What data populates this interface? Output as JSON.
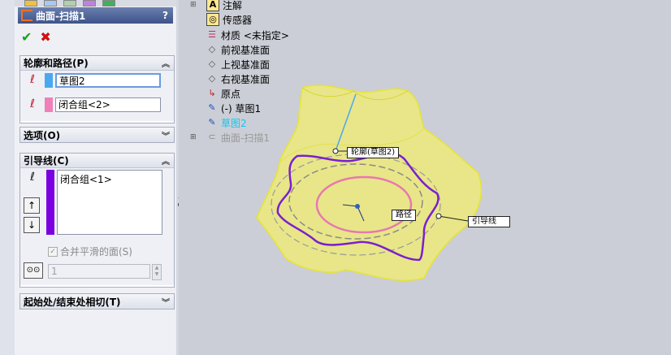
{
  "property_manager": {
    "title": "曲面-扫描1",
    "help": "?",
    "ok_symbol": "✔",
    "cancel_symbol": "✖",
    "profile_path": {
      "header": "轮廓和路径(P)",
      "profile_value": "草图2",
      "path_value": "闭合组<2>",
      "profile_color": "#4aa8f0",
      "path_color": "#f080b8"
    },
    "options": {
      "header": "选项(O)"
    },
    "guide_curves": {
      "header": "引导线(C)",
      "list_item": "闭合组<1>",
      "list_color": "#7a00e0",
      "up_arrow": "↑",
      "down_arrow": "↓",
      "merge_label": "合并平滑的面(S)",
      "merge_checked": true,
      "sections_value": "1"
    },
    "start_end_tangency": {
      "header": "起始处/结束处相切(T)"
    }
  },
  "feature_tree": {
    "items": [
      {
        "label": "注解",
        "icon": "annotations-icon",
        "expandable": true
      },
      {
        "label": "传感器",
        "icon": "sensor-icon",
        "expandable": false
      },
      {
        "label": "材质 <未指定>",
        "icon": "material-icon",
        "expandable": false
      },
      {
        "label": "前视基准面",
        "icon": "plane-icon",
        "expandable": false
      },
      {
        "label": "上视基准面",
        "icon": "plane-icon",
        "expandable": false
      },
      {
        "label": "右视基准面",
        "icon": "plane-icon",
        "expandable": false
      },
      {
        "label": "原点",
        "icon": "origin-icon",
        "expandable": false
      },
      {
        "label": "(-) 草图1",
        "icon": "sketch-icon",
        "expandable": false
      },
      {
        "label": "草图2",
        "icon": "sketch-icon",
        "expandable": false,
        "highlighted": true
      },
      {
        "label": "曲面-扫描1",
        "icon": "sweep-surface-icon",
        "expandable": true,
        "greyed": true
      }
    ]
  },
  "callouts": {
    "profile": "轮廓(草图2)",
    "path": "路径",
    "guide": "引导线"
  },
  "colors": {
    "surface": "#f2f06a",
    "guide_curve": "#7a1fd0",
    "path_curve": "#e878b0",
    "highlight_text": "#10c8f0"
  }
}
